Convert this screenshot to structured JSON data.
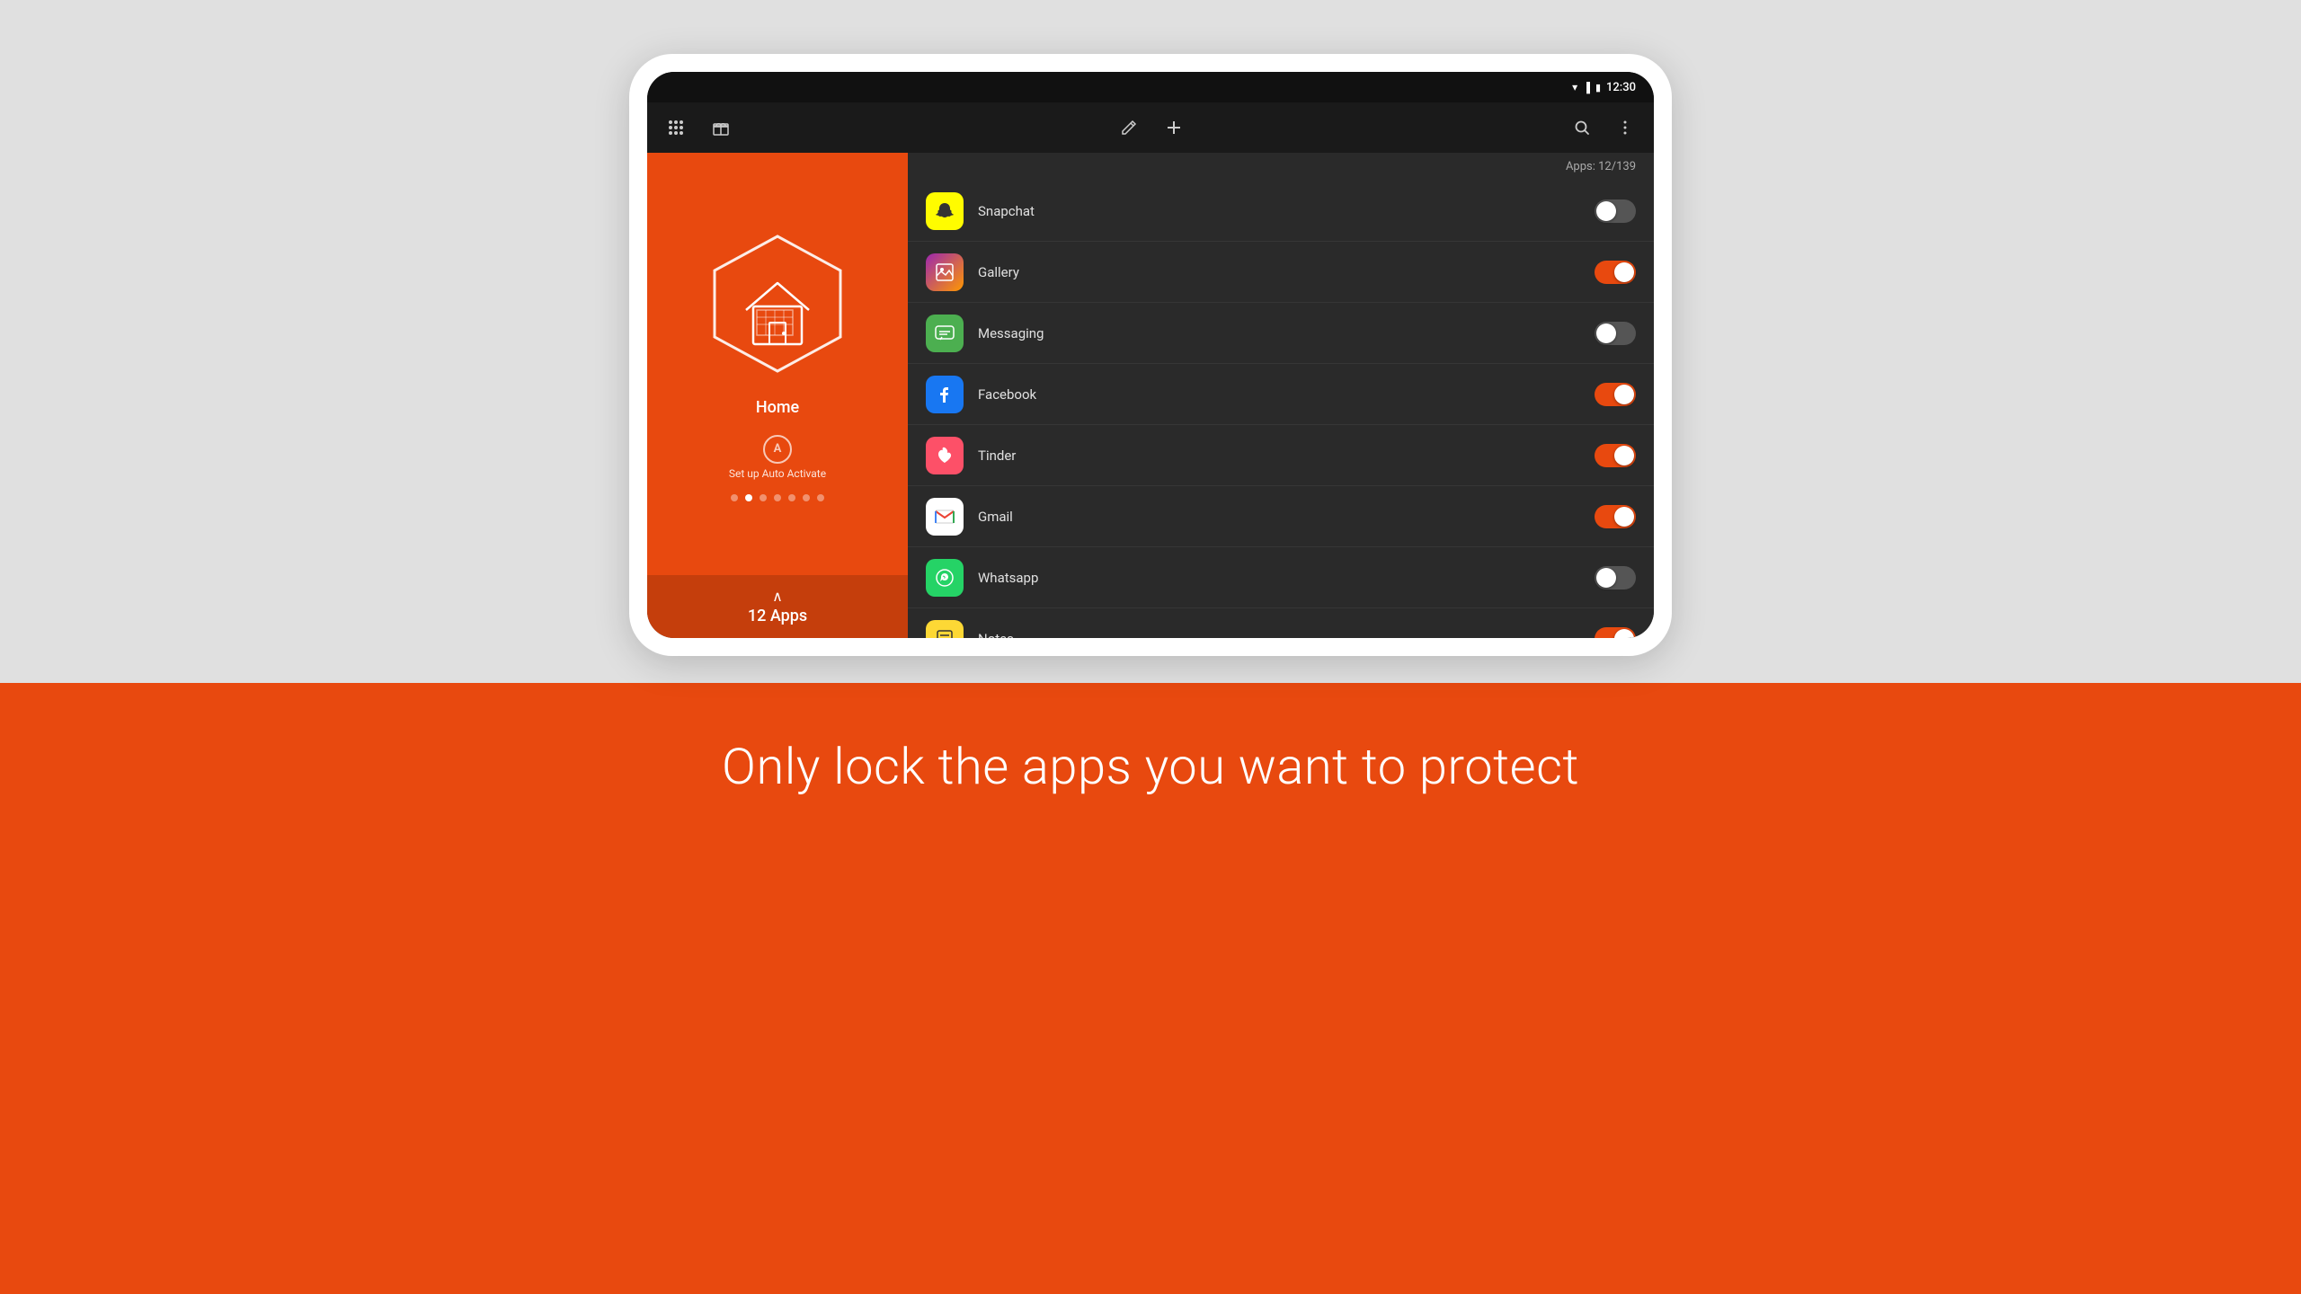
{
  "page": {
    "background_color": "#e8490f",
    "bottom_tagline": "Only lock the apps you want to protect"
  },
  "status_bar": {
    "time": "12:30"
  },
  "app_bar": {
    "grid_icon": "grid-icon",
    "gift_icon": "gift-icon",
    "edit_icon": "edit-icon",
    "add_icon": "add-icon",
    "search_icon": "search-icon",
    "more_icon": "more-icon"
  },
  "left_panel": {
    "home_label": "Home",
    "auto_activate_label": "Set up Auto Activate",
    "auto_activate_letter": "A",
    "dots": [
      {
        "active": false
      },
      {
        "active": true
      },
      {
        "active": false
      },
      {
        "active": false
      },
      {
        "active": false
      },
      {
        "active": false
      },
      {
        "active": false
      }
    ],
    "apps_count_label": "12 Apps"
  },
  "right_panel": {
    "apps_counter": "Apps: 12/139",
    "apps": [
      {
        "name": "Snapchat",
        "icon_type": "snapchat",
        "enabled": false
      },
      {
        "name": "Gallery",
        "icon_type": "gallery",
        "enabled": true
      },
      {
        "name": "Messaging",
        "icon_type": "messaging",
        "enabled": false
      },
      {
        "name": "Facebook",
        "icon_type": "facebook",
        "enabled": true
      },
      {
        "name": "Tinder",
        "icon_type": "tinder",
        "enabled": true
      },
      {
        "name": "Gmail",
        "icon_type": "gmail",
        "enabled": true
      },
      {
        "name": "Whatsapp",
        "icon_type": "whatsapp",
        "enabled": false
      },
      {
        "name": "Notes",
        "icon_type": "notes",
        "enabled": true
      }
    ]
  }
}
